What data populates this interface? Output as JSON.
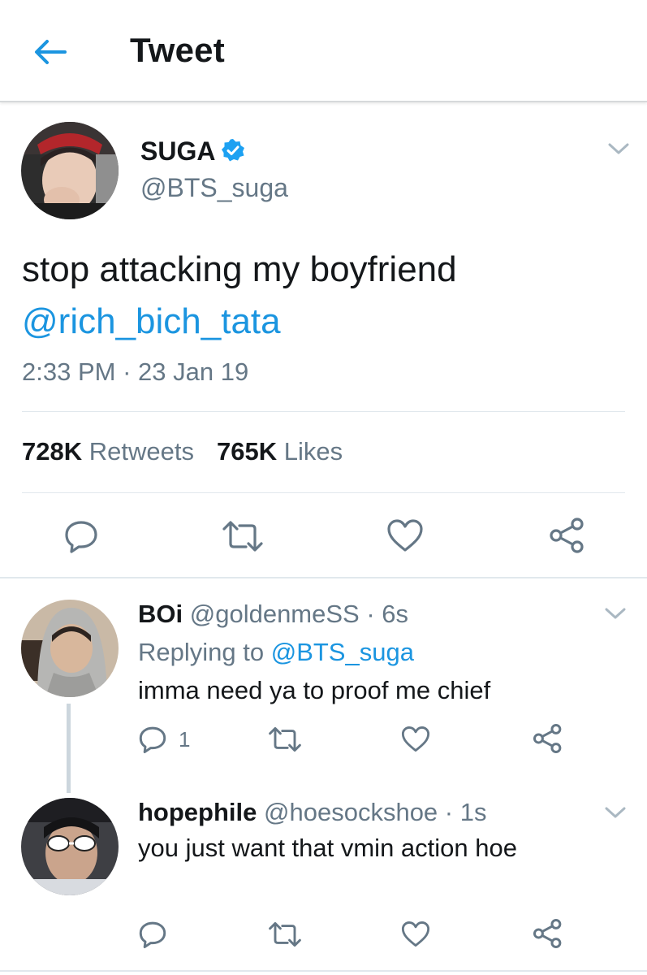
{
  "header": {
    "title": "Tweet"
  },
  "main_tweet": {
    "name": "SUGA",
    "handle": "@BTS_suga",
    "text": "stop attacking my boyfriend",
    "mention": "@rich_bich_tata",
    "time": "2:33 PM",
    "separator": " · ",
    "date": "23 Jan 19",
    "retweets_count": "728K",
    "retweets_label": "Retweets",
    "likes_count": "765K",
    "likes_label": "Likes"
  },
  "replies": [
    {
      "name": "BOi",
      "handle": "@goldenmeSS",
      "time": " · 6s",
      "replying_label": "Replying to ",
      "replying_to": "@BTS_suga",
      "text": "imma need ya to proof me chief",
      "reply_count": "1"
    },
    {
      "name": "hopephile",
      "handle": "@hoesockshoe",
      "time": " · 1s",
      "text": "you just want that vmin action hoe"
    }
  ],
  "colors": {
    "accent": "#1b95e0",
    "secondary_text": "#657786",
    "divider": "#e1e8ed"
  },
  "icons": [
    "back-arrow-icon",
    "verified-badge-icon",
    "chevron-down-icon",
    "reply-icon",
    "retweet-icon",
    "like-icon",
    "share-icon"
  ]
}
